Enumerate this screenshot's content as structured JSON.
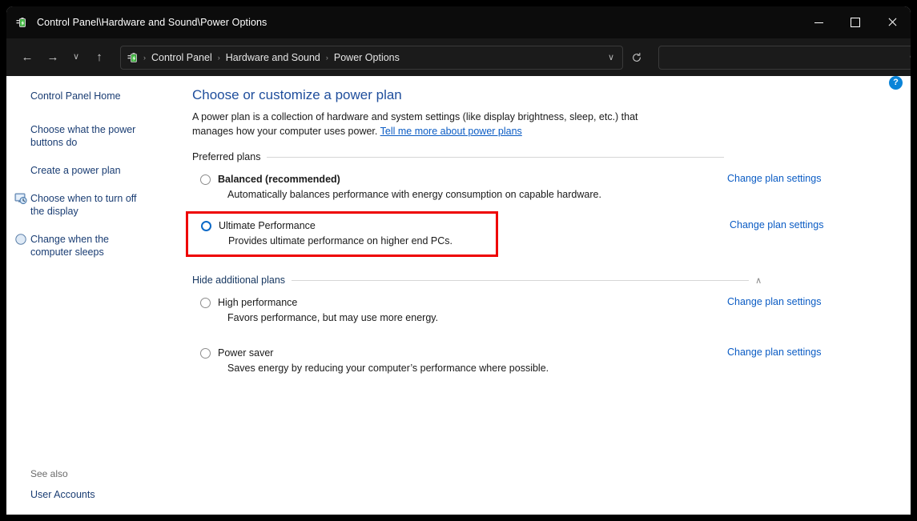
{
  "window": {
    "title": "Control Panel\\Hardware and Sound\\Power Options",
    "app_icon": "power-options-icon",
    "controls": {
      "minimize": "minimize-button",
      "maximize": "maximize-button",
      "close": "close-button"
    }
  },
  "nav": {
    "back": "←",
    "forward": "→",
    "recent": "∨",
    "up": "↑",
    "address_chevron": "∨",
    "refresh": "⟳",
    "breadcrumb": [
      {
        "label": "Control Panel"
      },
      {
        "label": "Hardware and Sound"
      },
      {
        "label": "Power Options"
      }
    ],
    "separator": "›"
  },
  "search": {
    "value": "",
    "placeholder": "",
    "icon": "search-icon"
  },
  "sidebar": {
    "items": [
      {
        "label": "Control Panel Home",
        "icon": null
      },
      {
        "label": "Choose what the power buttons do",
        "icon": null
      },
      {
        "label": "Create a power plan",
        "icon": null
      },
      {
        "label": "Choose when to turn off the display",
        "icon": "display-clock-icon"
      },
      {
        "label": "Change when the computer sleeps",
        "icon": "sleep-moon-icon"
      }
    ],
    "see_also_title": "See also",
    "see_also_items": [
      {
        "label": "User Accounts"
      }
    ]
  },
  "main": {
    "help_button": "?",
    "title": "Choose or customize a power plan",
    "description": "A power plan is a collection of hardware and system settings (like display brightness, sleep, etc.) that manages how your computer uses power.",
    "description_link": "Tell me more about power plans",
    "preferred_section": "Preferred plans",
    "additional_section": "Hide additional plans",
    "additional_section_chevron": "∧",
    "change_link": "Change plan settings",
    "preferred_plans": [
      {
        "name": "Balanced (recommended)",
        "desc": "Automatically balances performance with energy consumption on capable hardware.",
        "selected": false,
        "bold": true,
        "highlighted": false
      },
      {
        "name": "Ultimate Performance",
        "desc": "Provides ultimate performance on higher end PCs.",
        "selected": true,
        "bold": false,
        "highlighted": true
      }
    ],
    "additional_plans": [
      {
        "name": "High performance",
        "desc": "Favors performance, but may use more energy.",
        "selected": false,
        "bold": false,
        "highlighted": false
      },
      {
        "name": "Power saver",
        "desc": "Saves energy by reducing your computer’s performance where possible.",
        "selected": false,
        "bold": false,
        "highlighted": false
      }
    ]
  },
  "colors": {
    "accent_link": "#0b5cc4",
    "title_blue": "#1f4e9c",
    "highlight_red": "#ee0000",
    "radio_selected": "#0b69c7",
    "help_blue": "#0a84d8",
    "titlebar_bg": "#0c0c0c",
    "navbar_bg": "#191919"
  }
}
